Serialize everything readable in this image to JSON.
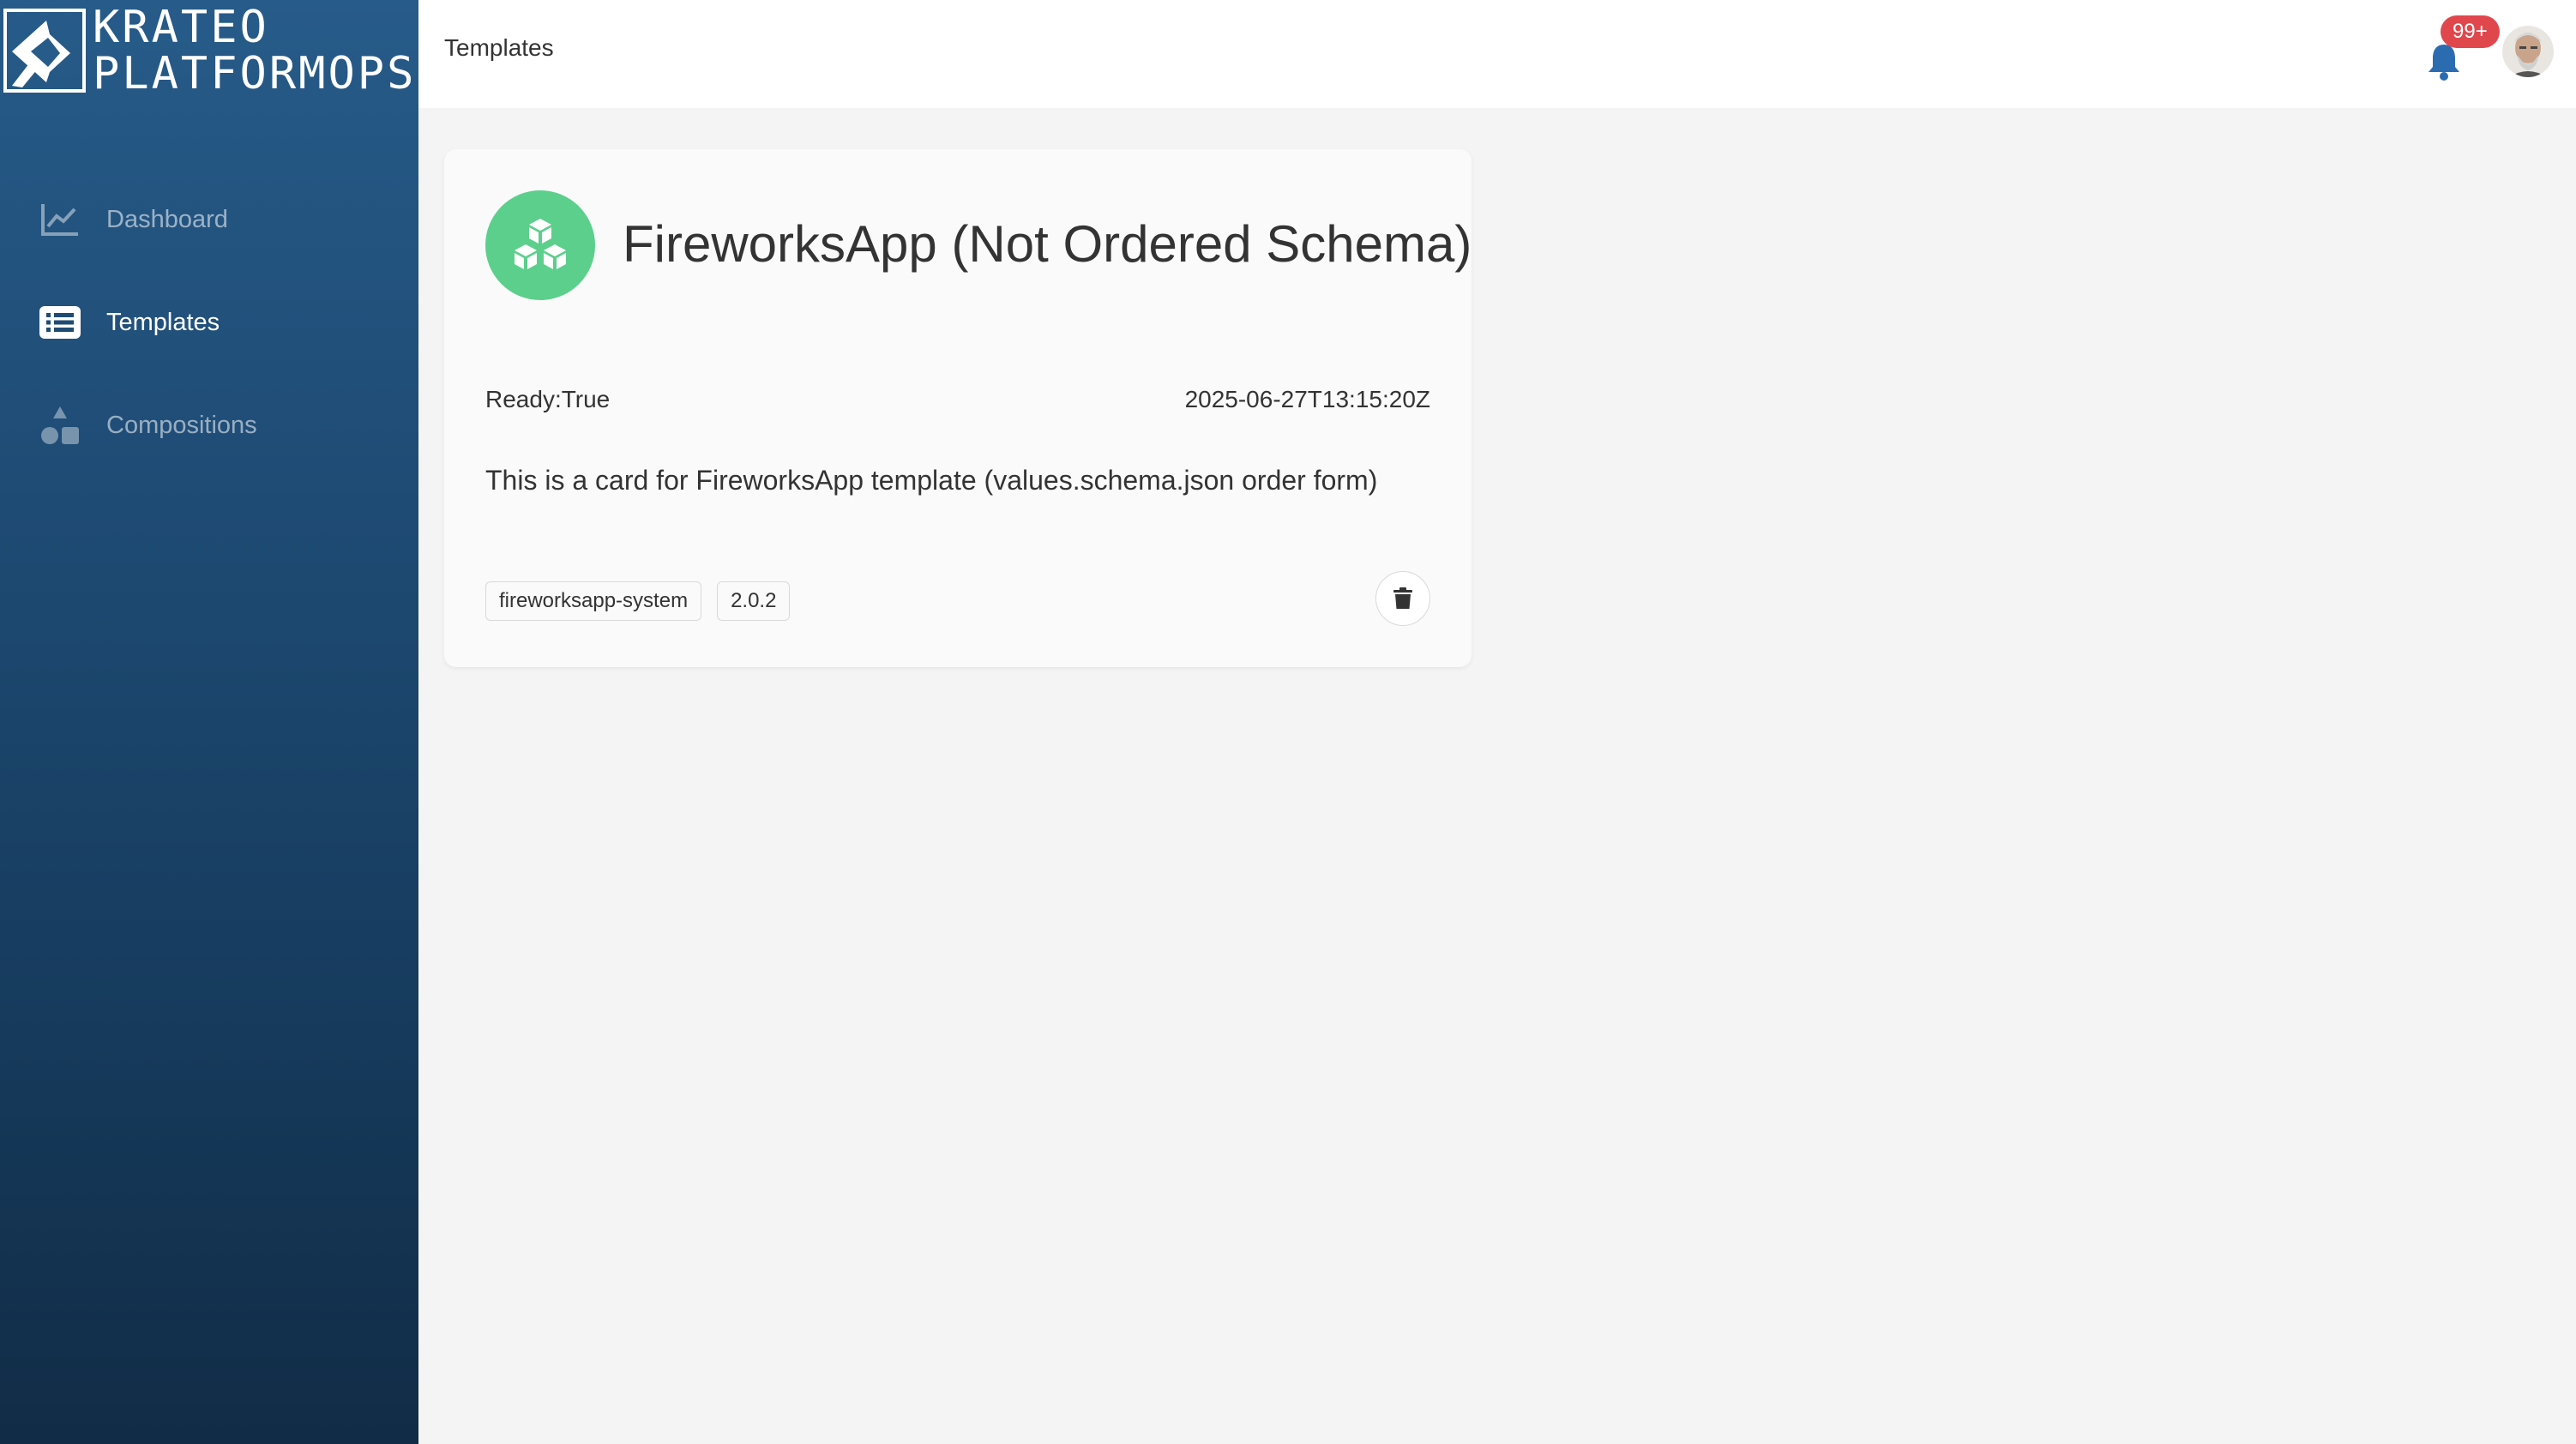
{
  "brand": {
    "line1": "KRATEO",
    "line2": "PLATFORMOPS"
  },
  "sidebar": {
    "items": [
      {
        "label": "Dashboard",
        "icon": "line-chart-icon",
        "active": false
      },
      {
        "label": "Templates",
        "icon": "list-icon",
        "active": true
      },
      {
        "label": "Compositions",
        "icon": "shapes-icon",
        "active": false
      }
    ]
  },
  "header": {
    "breadcrumb": "Templates",
    "notifications_badge": "99+"
  },
  "card": {
    "title": "FireworksApp (Not Ordered Schema)",
    "status": "Ready:True",
    "date": "2025-06-27T13:15:20Z",
    "description": "This is a card for FireworksApp template (values.schema.json order form)",
    "tags": [
      "fireworksapp-system",
      "2.0.2"
    ],
    "icon": "cubes-icon",
    "icon_color": "#5ccf8c"
  },
  "colors": {
    "sidebar_top": "#275b89",
    "sidebar_bottom": "#112c46",
    "badge": "#e0474c",
    "bell": "#2b6cb0"
  }
}
